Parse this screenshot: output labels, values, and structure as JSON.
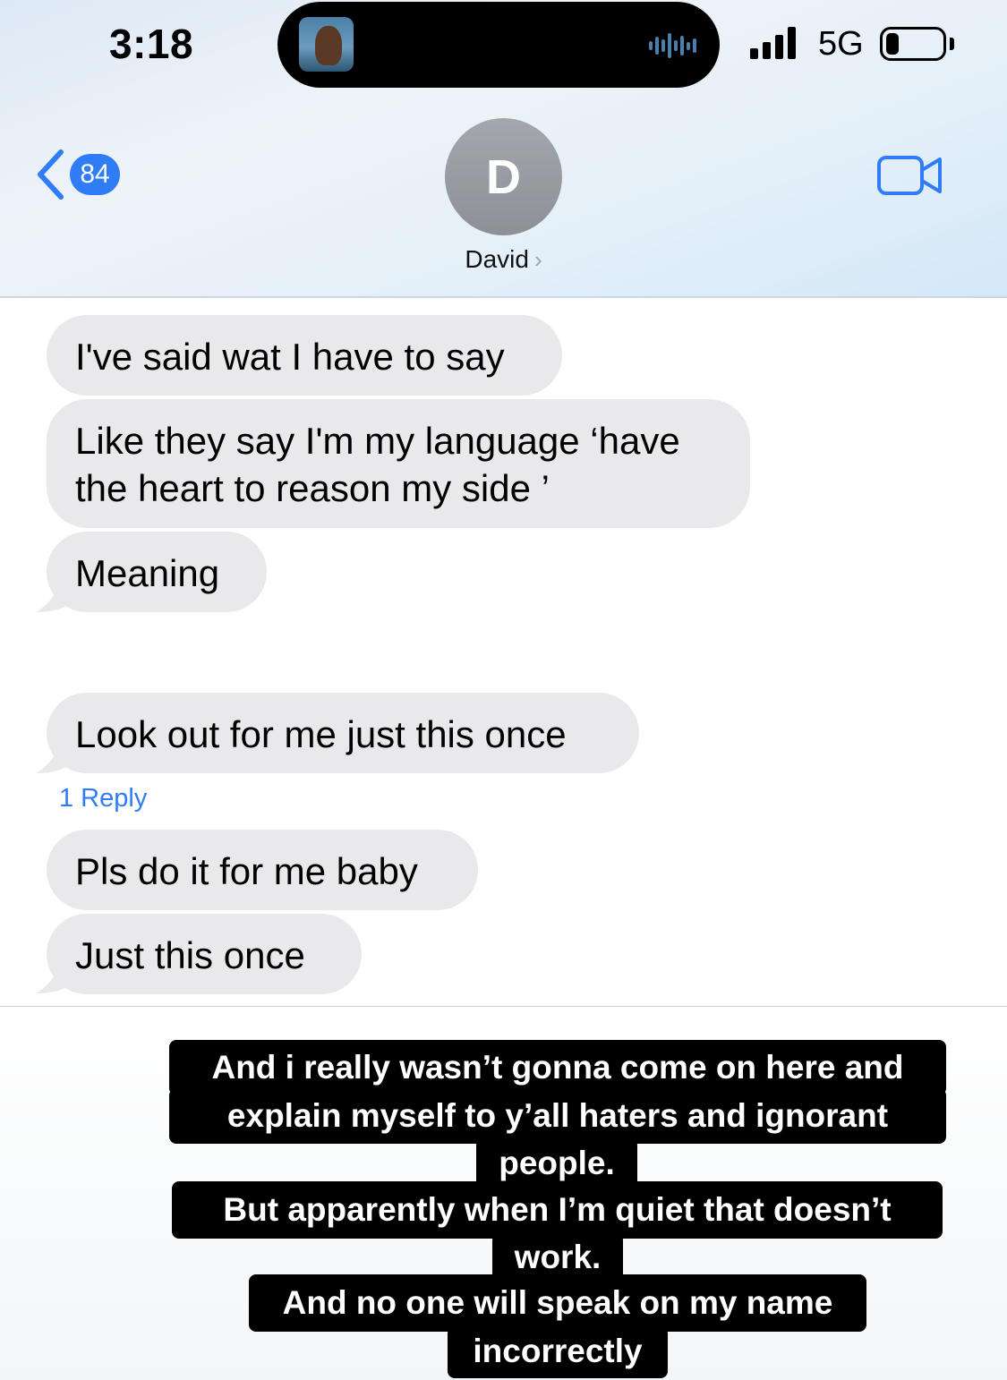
{
  "status_bar": {
    "time": "3:18",
    "network": "5G",
    "battery_level": 0.24,
    "now_playing_icon": "album-art-thumbnail",
    "audio_icon": "waveform-icon"
  },
  "header": {
    "back_count": "84",
    "avatar_initial": "D",
    "contact_name": "David",
    "name_caret": "›",
    "video_icon": "video-camera-icon"
  },
  "messages": [
    {
      "text": "I've said wat I have to say",
      "tail": false
    },
    {
      "text": "Like they say I'm my language ‘have the heart to reason my side ’",
      "tail": false
    },
    {
      "text": "Meaning",
      "tail": true
    },
    {
      "text": "Look out for me just this once",
      "tail": true
    },
    {
      "text": "Pls do it for me baby",
      "tail": false
    },
    {
      "text": "Just this once",
      "tail": true
    }
  ],
  "reply_link": "1 Reply",
  "caption": {
    "lines": [
      "And i really wasn’t gonna come on here and",
      "explain myself to y’all haters and ignorant",
      "people.",
      "But apparently when I’m quiet that doesn’t",
      "work.",
      "And no one will speak on my name",
      "incorrectly"
    ]
  },
  "colors": {
    "accent_blue": "#2f7cf6",
    "bubble_gray": "#e9e9eb",
    "caption_bg": "#000000"
  }
}
